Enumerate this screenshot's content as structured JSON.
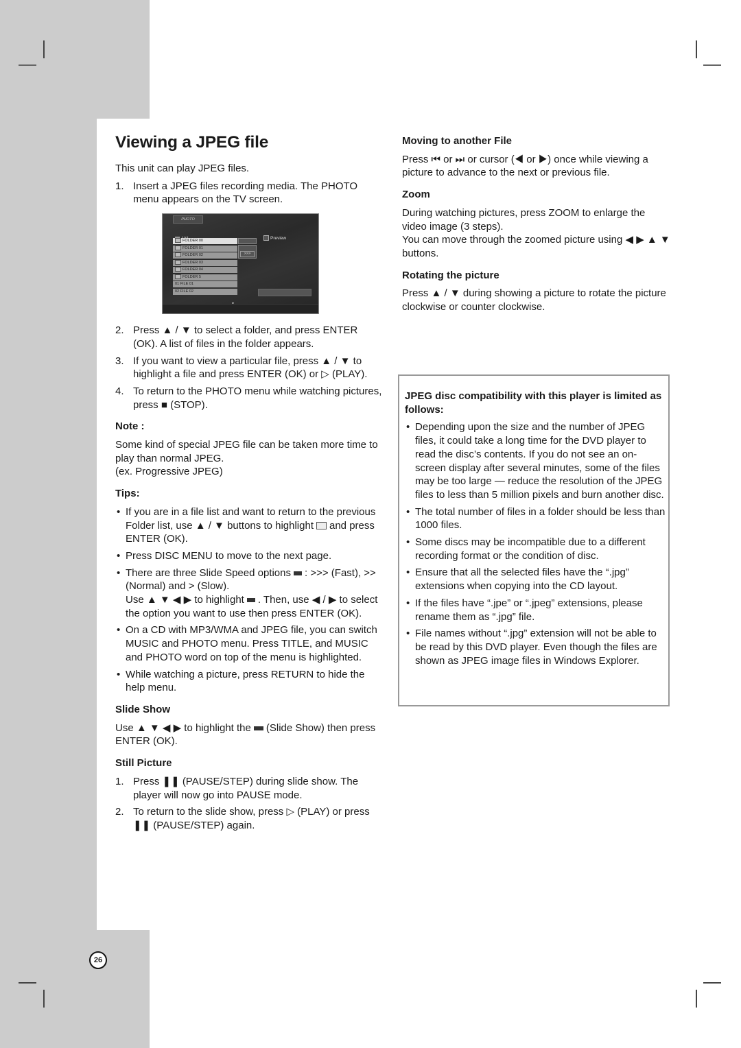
{
  "page": {
    "title": "Viewing a JPEG file",
    "page_number": "26"
  },
  "left": {
    "intro": "This unit can play JPEG files.",
    "steps": [
      {
        "n": "1.",
        "text": "Insert a JPEG files recording media. The PHOTO menu appears on the TV screen."
      },
      {
        "n": "2.",
        "text": "Press ▲ / ▼ to select a folder, and press ENTER (OK). A list of files in the folder appears."
      },
      {
        "n": "3.",
        "text": "If you want to view a particular file, press ▲ / ▼ to highlight a file and press ENTER (OK) or ▷ (PLAY)."
      },
      {
        "n": "4.",
        "text": "To return to the PHOTO menu while watching pictures, press ■ (STOP)."
      }
    ],
    "note_heading": "Note :",
    "note_lines": [
      "Some kind of special JPEG file can be taken more time to play than normal JPEG.",
      "(ex. Progressive JPEG)"
    ],
    "tips_heading": "Tips:",
    "tips": [
      {
        "a": "If you are in a file list and want to return to the previous Folder list, use ▲ / ▼ buttons to highlight",
        "b": "and press ENTER (OK)."
      },
      {
        "a": "Press DISC MENU to move to the next page."
      },
      {
        "a": "There are three Slide Speed options",
        "b": ": >>> (Fast), >> (Normal) and > (Slow).",
        "c": "Use ▲ ▼ ◀ ▶ to highlight",
        "d": ". Then, use ◀ / ▶ to select the option you want to use then press ENTER (OK)."
      },
      {
        "a": "On a CD with MP3/WMA and JPEG file, you can switch MUSIC and PHOTO menu. Press TITLE, and MUSIC and PHOTO word on top of the menu is highlighted."
      },
      {
        "a": "While watching a picture, press RETURN to hide the help menu."
      }
    ],
    "slideshow_heading": "Slide Show",
    "slideshow_a": "Use ▲ ▼ ◀ ▶ to highlight the",
    "slideshow_b": "(Slide Show) then press ENTER (OK).",
    "still_heading": "Still Picture",
    "still_steps": [
      {
        "n": "1.",
        "text": "Press ❚❚ (PAUSE/STEP) during slide show. The player will now go into PAUSE mode."
      },
      {
        "n": "2.",
        "text": "To return to the slide show, press ▷ (PLAY) or press ❚❚ (PAUSE/STEP) again."
      }
    ]
  },
  "tv_menu": {
    "tab": "PHOTO",
    "list_label": "List",
    "preview_label": "Preview",
    "rows": [
      "FOLDER 00",
      "FOLDER 01",
      "FOLDER 02",
      "FOLDER 03",
      "FOLDER 04",
      "FOLDER 5",
      "01  FILE 01",
      "02  FILE 02"
    ],
    "selected_row": 0,
    "speed": ">>>",
    "more_indicator": "▼"
  },
  "right": {
    "moving_heading": "Moving to another File",
    "moving_text": "Press ⏮ or ⏭ or cursor (◀ or ▶) once while viewing a picture to advance to the next or previous file.",
    "zoom_heading": "Zoom",
    "zoom_text1": "During watching pictures, press ZOOM to enlarge the video image (3 steps).",
    "zoom_text2": "You can move through the zoomed picture using ◀ ▶ ▲ ▼ buttons.",
    "rotate_heading": "Rotating the picture",
    "rotate_text": "Press ▲ / ▼ during showing a picture to rotate the picture clockwise or counter clockwise."
  },
  "compat_box": {
    "heading": "JPEG disc compatibility with this player is limited as follows:",
    "items": [
      "Depending upon the size and the number of JPEG files, it could take a long time for the DVD player to read the disc’s contents. If you do not see an on-screen display after several minutes, some of the files may be too large — reduce the resolution of the JPEG files to less than 5 million pixels and burn another disc.",
      "The total number of files in a folder should be less than 1000 files.",
      "Some discs may be incompatible due to a different recording format or the condition of disc.",
      "Ensure that all the selected files have the “.jpg” extensions when copying into the CD layout.",
      "If the files have “.jpe” or “.jpeg” extensions, please rename them as “.jpg” file.",
      "File names without “.jpg” extension will not be able to be read by this DVD player. Even though the files are shown as JPEG image files in Windows Explorer."
    ]
  },
  "bullet": "•"
}
